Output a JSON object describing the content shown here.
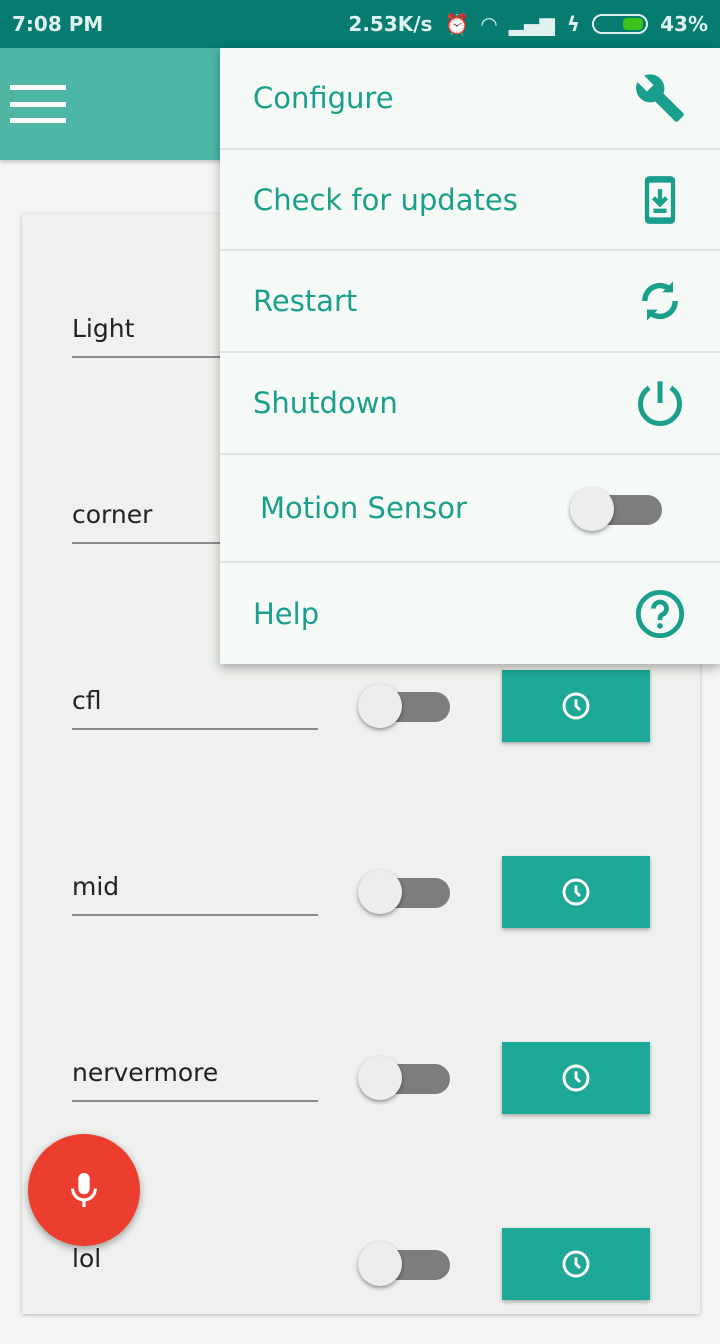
{
  "status_bar": {
    "time": "7:08 PM",
    "net_speed": "2.53K/s",
    "battery": "43%",
    "battery_level": 0.43
  },
  "colors": {
    "accent": "#1ea896",
    "toolbar": "#4db6a5",
    "fab": "#ec3e2e"
  },
  "menu": {
    "items": [
      {
        "label": "Configure",
        "icon": "wrench-icon"
      },
      {
        "label": "Check for updates",
        "icon": "phone-download-icon"
      },
      {
        "label": "Restart",
        "icon": "refresh-icon"
      },
      {
        "label": "Shutdown",
        "icon": "power-icon"
      },
      {
        "label": "Motion Sensor",
        "toggle": false
      },
      {
        "label": "Help",
        "icon": "help-circle-icon"
      }
    ]
  },
  "devices": [
    {
      "name": "Light",
      "on": false
    },
    {
      "name": "corner",
      "on": false
    },
    {
      "name": "cfl",
      "on": false
    },
    {
      "name": "mid",
      "on": false
    },
    {
      "name": "nervermore",
      "on": false
    },
    {
      "name": "lol",
      "on": false
    }
  ]
}
